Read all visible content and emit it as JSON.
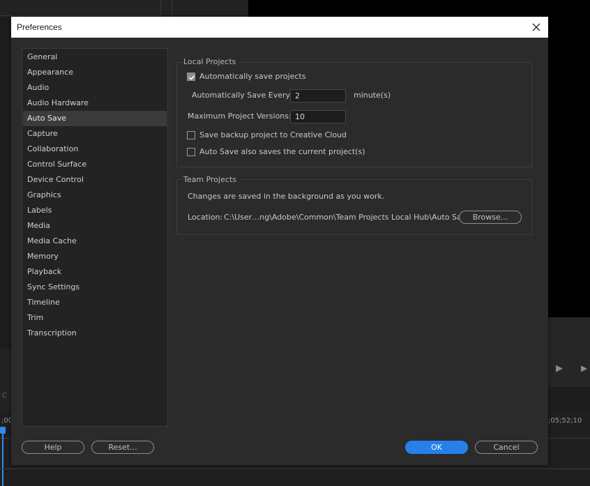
{
  "background": {
    "timecode_left": ";00",
    "timecode_right": ";05;52;10",
    "panel_letter": "C"
  },
  "dialog": {
    "title": "Preferences"
  },
  "sidebar": {
    "selected": "Auto Save",
    "items": [
      {
        "label": "General"
      },
      {
        "label": "Appearance"
      },
      {
        "label": "Audio"
      },
      {
        "label": "Audio Hardware"
      },
      {
        "label": "Auto Save"
      },
      {
        "label": "Capture"
      },
      {
        "label": "Collaboration"
      },
      {
        "label": "Control Surface"
      },
      {
        "label": "Device Control"
      },
      {
        "label": "Graphics"
      },
      {
        "label": "Labels"
      },
      {
        "label": "Media"
      },
      {
        "label": "Media Cache"
      },
      {
        "label": "Memory"
      },
      {
        "label": "Playback"
      },
      {
        "label": "Sync Settings"
      },
      {
        "label": "Timeline"
      },
      {
        "label": "Trim"
      },
      {
        "label": "Transcription"
      }
    ]
  },
  "local_projects": {
    "title": "Local Projects",
    "auto_save_label": "Automatically save projects",
    "auto_save_checked": true,
    "interval_label": "Automatically Save Every:",
    "interval_value": "2",
    "interval_unit": "minute(s)",
    "max_versions_label": "Maximum Project Versions:",
    "max_versions_value": "10",
    "backup_cloud_label": "Save backup project to Creative Cloud",
    "backup_cloud_checked": false,
    "save_current_label": "Auto Save also saves the current project(s)",
    "save_current_checked": false
  },
  "team_projects": {
    "title": "Team Projects",
    "info": "Changes are saved in the background as you work.",
    "location_label": "Location:",
    "location_path": "C:\\User…ng\\Adobe\\Common\\Team Projects Local Hub\\Auto Saves",
    "browse_label": "Browse..."
  },
  "footer": {
    "help_label": "Help",
    "reset_label": "Reset...",
    "ok_label": "OK",
    "cancel_label": "Cancel"
  },
  "colors": {
    "accent": "#2680eb",
    "dialog_bg": "#2b2b2b",
    "selected_item": "#3b3b3b"
  }
}
